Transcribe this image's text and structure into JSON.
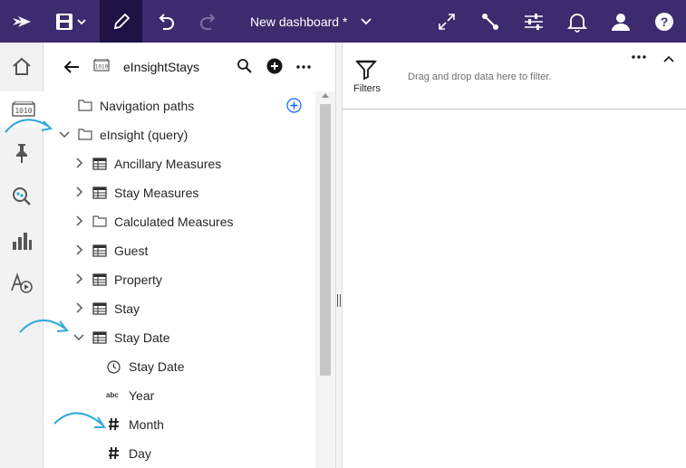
{
  "topbar": {
    "title": "New dashboard *"
  },
  "panel": {
    "title": "eInsightStays"
  },
  "tree": [
    {
      "label": "Navigation paths",
      "icon": "folder-icon",
      "chevron": "none",
      "level": 0
    },
    {
      "label": "eInsight (query)",
      "icon": "folder-icon",
      "chevron": "down",
      "level": 0
    },
    {
      "label": "Ancillary Measures",
      "icon": "table-icon",
      "chevron": "right",
      "level": 1
    },
    {
      "label": "Stay Measures",
      "icon": "table-icon",
      "chevron": "right",
      "level": 1
    },
    {
      "label": "Calculated Measures",
      "icon": "folder-icon",
      "chevron": "right",
      "level": 1
    },
    {
      "label": "Guest",
      "icon": "table-icon",
      "chevron": "right",
      "level": 1
    },
    {
      "label": "Property",
      "icon": "table-icon",
      "chevron": "right",
      "level": 1
    },
    {
      "label": "Stay",
      "icon": "table-icon",
      "chevron": "right",
      "level": 1
    },
    {
      "label": "Stay Date",
      "icon": "table-icon",
      "chevron": "down",
      "level": 1
    },
    {
      "label": "Stay Date",
      "icon": "clock-icon",
      "chevron": "none",
      "level": 2
    },
    {
      "label": "Year",
      "icon": "abc-icon",
      "chevron": "none",
      "level": 2
    },
    {
      "label": "Month",
      "icon": "hash-icon",
      "chevron": "none",
      "level": 2
    },
    {
      "label": "Day",
      "icon": "hash-icon",
      "chevron": "none",
      "level": 2
    }
  ],
  "abc_glyph": "abc",
  "filters": {
    "label": "Filters",
    "hint": "Drag and drop data here to filter."
  },
  "colors": {
    "topbar": "#3c2b6e",
    "topbar_active": "#1d1243",
    "annotation_arrow": "#2fa8dc"
  }
}
